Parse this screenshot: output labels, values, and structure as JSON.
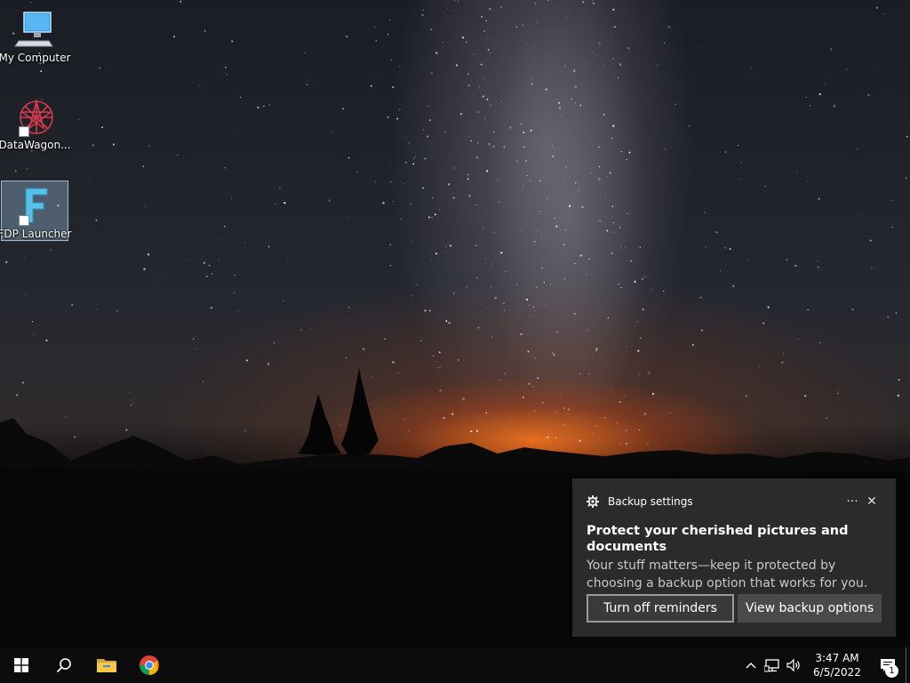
{
  "desktop": {
    "icons": [
      {
        "label": "My Computer",
        "icon": "computer-icon"
      },
      {
        "label": "DataWagon...",
        "icon": "datawagon-icon"
      },
      {
        "label": "FDP Launcher",
        "icon": "fdp-launcher-icon"
      }
    ]
  },
  "toast": {
    "app_name": "Backup settings",
    "title": "Protect your cherished pictures and documents",
    "body": "Your stuff matters—keep it protected by choosing a backup option that works for you.",
    "more_label": "···",
    "close_label": "✕",
    "buttons": {
      "turn_off": "Turn off reminders",
      "view_options": "View backup options"
    }
  },
  "taskbar": {
    "clock": {
      "time": "3:47 AM",
      "date": "6/5/2022"
    },
    "notification_count": "1",
    "tray_chevron": "^"
  },
  "colors": {
    "toast_bg": "#2b2b2b",
    "taskbar_bg": "#0c0c0d",
    "chrome_red": "#db4437",
    "chrome_green": "#0f9d58",
    "chrome_yellow": "#f4b400",
    "chrome_blue": "#4285f4",
    "folder_yellow": "#f7c845"
  }
}
